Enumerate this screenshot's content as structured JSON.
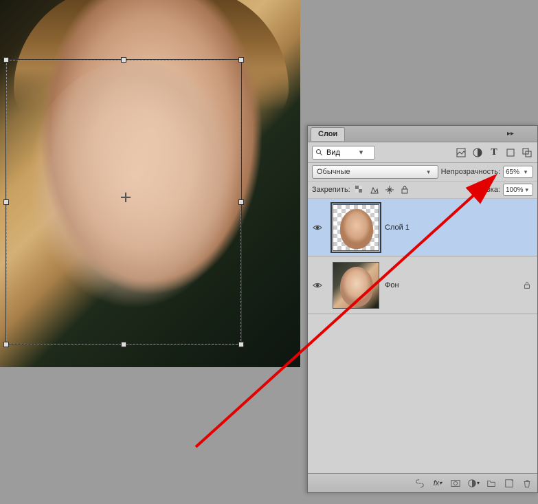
{
  "panel": {
    "tab_title": "Слои",
    "search_label": "Вид",
    "blend_mode": "Обычные",
    "opacity_label": "Непрозрачность:",
    "opacity_value": "65%",
    "lock_label": "Закрепить:",
    "fill_label": "Заливка:",
    "fill_value": "100%",
    "layers": [
      {
        "name": "Слой 1",
        "locked": false
      },
      {
        "name": "Фон",
        "locked": true
      }
    ]
  },
  "icons": {
    "search": "search",
    "filter_image": "image",
    "filter_adjust": "adjust",
    "filter_type": "T",
    "filter_shape": "shape",
    "filter_smart": "smart"
  }
}
